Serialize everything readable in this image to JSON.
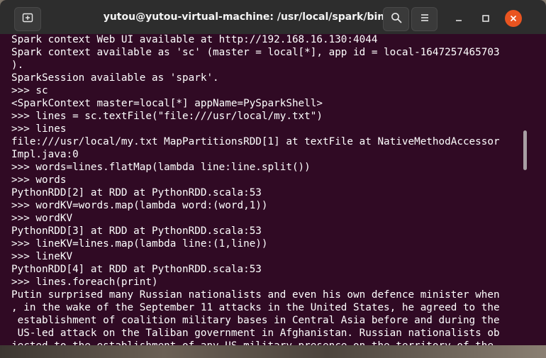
{
  "window": {
    "title": "yutou@yutou-virtual-machine: /usr/local/spark/bin",
    "icons": {
      "new_tab": "new-tab-icon",
      "search": "search-icon",
      "menu": "hamburger-menu-icon",
      "minimize": "minimize-icon",
      "maximize": "maximize-icon",
      "close": "close-icon"
    },
    "colors": {
      "titlebar": "#2d2d2d",
      "terminal_bg": "#300a24",
      "close_button": "#e95420",
      "text": "#ffffff"
    }
  },
  "terminal": {
    "lines": [
      "Spark context Web UI available at http://192.168.16.130:4044",
      "Spark context available as 'sc' (master = local[*], app id = local-1647257465703",
      ").",
      "SparkSession available as 'spark'.",
      ">>> sc",
      "<SparkContext master=local[*] appName=PySparkShell>",
      ">>> lines = sc.textFile(\"file:///usr/local/my.txt\")",
      ">>> lines",
      "file:///usr/local/my.txt MapPartitionsRDD[1] at textFile at NativeMethodAccessor",
      "Impl.java:0",
      ">>> words=lines.flatMap(lambda line:line.split())",
      ">>> words",
      "PythonRDD[2] at RDD at PythonRDD.scala:53",
      ">>> wordKV=words.map(lambda word:(word,1))",
      ">>> wordKV",
      "PythonRDD[3] at RDD at PythonRDD.scala:53",
      ">>> lineKV=lines.map(lambda line:(1,line))",
      ">>> lineKV",
      "PythonRDD[4] at RDD at PythonRDD.scala:53",
      ">>> lines.foreach(print)",
      "Putin surprised many Russian nationalists and even his own defence minister when",
      ", in the wake of the September 11 attacks in the United States, he agreed to the",
      " establishment of coalition military bases in Central Asia before and during the",
      " US-led attack on the Taliban government in Afghanistan. Russian nationalists ob",
      "jected to the establishment of any US military presence on the territory of the"
    ]
  }
}
